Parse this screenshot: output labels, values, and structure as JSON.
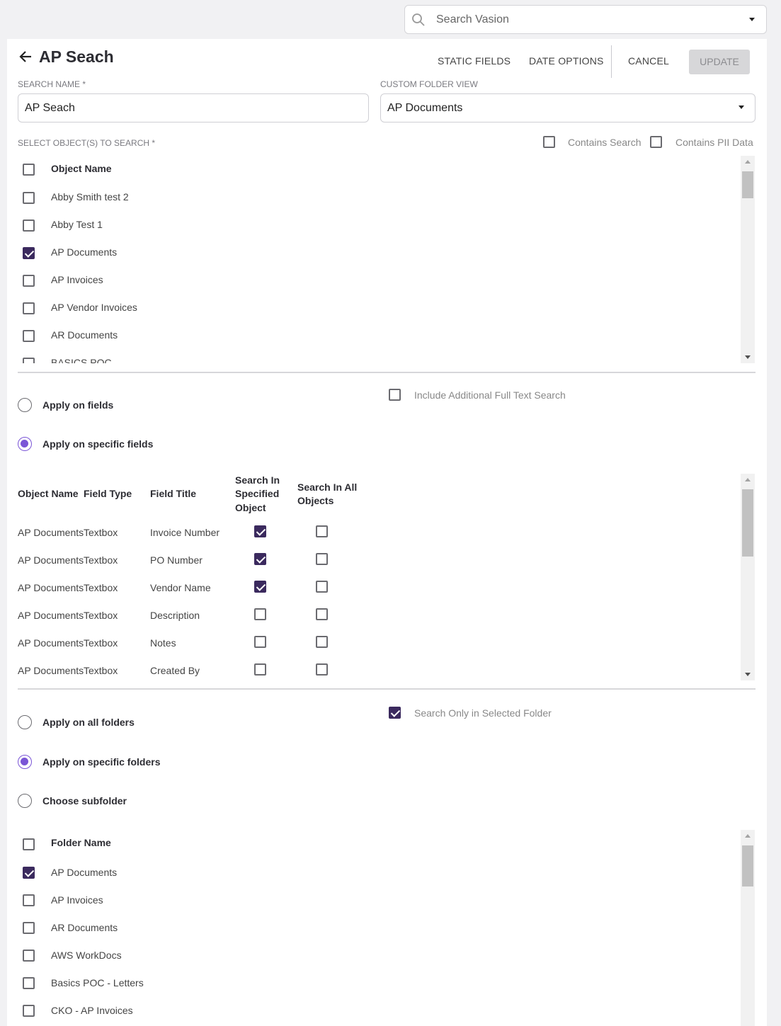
{
  "global_search": {
    "placeholder": "Search Vasion"
  },
  "header": {
    "title": "AP Seach",
    "static_fields": "STATIC FIELDS",
    "date_options": "DATE OPTIONS",
    "cancel": "CANCEL",
    "update": "UPDATE"
  },
  "form": {
    "search_name_label": "SEARCH NAME *",
    "search_name_value": "AP Seach",
    "folder_view_label": "CUSTOM FOLDER VIEW",
    "folder_view_value": "AP Documents",
    "objects_label": "SELECT OBJECT(S) TO SEARCH *",
    "contains_search": "Contains Search",
    "contains_pii": "Contains PII Data"
  },
  "objects": {
    "header": "Object Name",
    "items": [
      {
        "name": "Abby Smith test 2",
        "checked": false
      },
      {
        "name": "Abby Test 1",
        "checked": false
      },
      {
        "name": "AP Documents",
        "checked": true
      },
      {
        "name": "AP Invoices",
        "checked": false
      },
      {
        "name": "AP Vendor Invoices",
        "checked": false
      },
      {
        "name": "AR Documents",
        "checked": false
      },
      {
        "name": "BASICS POC",
        "checked": false
      }
    ]
  },
  "field_scope": {
    "apply_fields": "Apply on fields",
    "apply_specific_fields": "Apply on specific fields",
    "selected": "specific",
    "full_text": "Include Additional Full Text Search",
    "full_text_checked": false
  },
  "fields_table": {
    "headers": {
      "object_name": "Object Name",
      "field_type": "Field Type",
      "field_title": "Field Title",
      "specified_1": "Search In",
      "specified_2": "Specified",
      "specified_3": "Object",
      "all_1": "Search In All",
      "all_2": "Objects"
    },
    "rows": [
      {
        "object": "AP Documents",
        "type": "Textbox",
        "title": "Invoice Number",
        "specified": true,
        "all": false
      },
      {
        "object": "AP Documents",
        "type": "Textbox",
        "title": "PO Number",
        "specified": true,
        "all": false
      },
      {
        "object": "AP Documents",
        "type": "Textbox",
        "title": "Vendor Name",
        "specified": true,
        "all": false
      },
      {
        "object": "AP Documents",
        "type": "Textbox",
        "title": "Description",
        "specified": false,
        "all": false
      },
      {
        "object": "AP Documents",
        "type": "Textbox",
        "title": "Notes",
        "specified": false,
        "all": false
      },
      {
        "object": "AP Documents",
        "type": "Textbox",
        "title": "Created By",
        "specified": false,
        "all": false
      }
    ]
  },
  "folder_scope": {
    "apply_all": "Apply on all folders",
    "apply_specific": "Apply on specific folders",
    "choose_sub": "Choose subfolder",
    "selected": "specific",
    "only_selected": "Search Only in Selected Folder",
    "only_selected_checked": true
  },
  "folders": {
    "header": "Folder Name",
    "items": [
      {
        "name": "AP Documents",
        "checked": true
      },
      {
        "name": "AP Invoices",
        "checked": false
      },
      {
        "name": "AR Documents",
        "checked": false
      },
      {
        "name": "AWS WorkDocs",
        "checked": false
      },
      {
        "name": "Basics POC - Letters",
        "checked": false
      },
      {
        "name": "CKO - AP Invoices",
        "checked": false
      }
    ]
  },
  "colors": {
    "accent": "#7a55d6",
    "check": "#3b2a5e"
  }
}
